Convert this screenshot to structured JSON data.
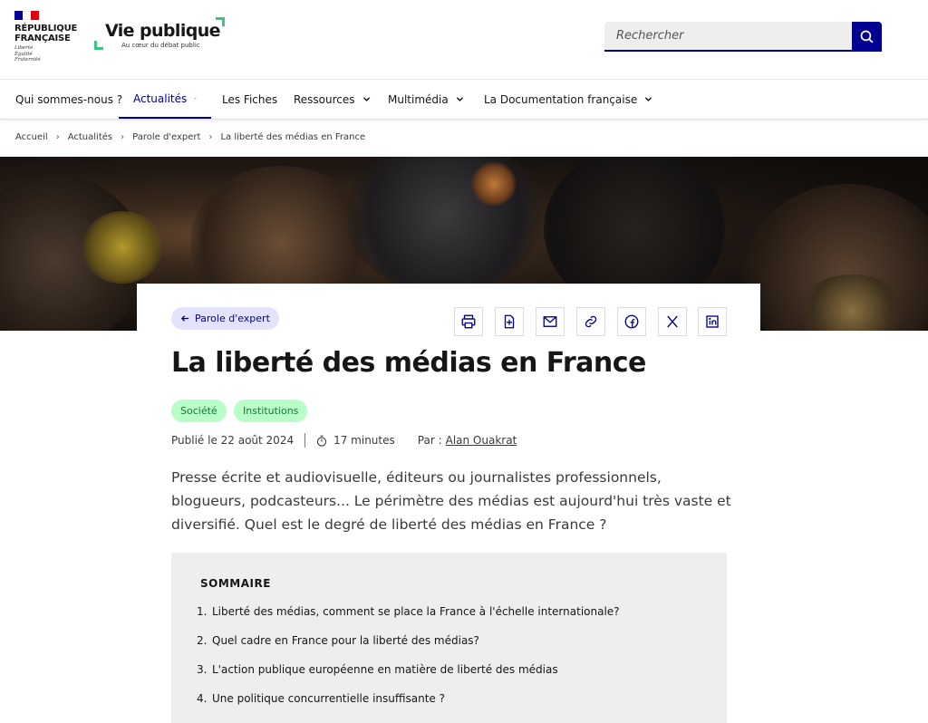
{
  "header": {
    "rf_name_line1": "RÉPUBLIQUE",
    "rf_name_line2": "FRANÇAISE",
    "rf_motto_1": "Liberté",
    "rf_motto_2": "Égalité",
    "rf_motto_3": "Fraternité",
    "site_title": "Vie publique",
    "site_subtitle": "Au cœur du débat public",
    "search_placeholder": "Rechercher",
    "accent_color": "#000091",
    "logo_green": "#3ec27f"
  },
  "nav": {
    "items": [
      {
        "label": "Qui sommes-nous ?",
        "icon": ""
      },
      {
        "label": "Actualités",
        "icon": "chevron-down-icon"
      },
      {
        "label": "Les Fiches",
        "icon": ""
      },
      {
        "label": "Ressources",
        "icon": "chevron-down-icon"
      },
      {
        "label": "Multimédia",
        "icon": "chevron-down-icon"
      },
      {
        "label": "La Documentation française",
        "icon": "chevron-down-icon"
      }
    ],
    "active": "Actualités"
  },
  "breadcrumb": [
    "Accueil",
    "Actualités",
    "Parole d'expert",
    "La liberté des médias en France"
  ],
  "article": {
    "back_label": "Parole d'expert",
    "share_icons": [
      "print-icon",
      "download-icon",
      "mail-icon",
      "link-icon",
      "facebook-icon",
      "x-icon",
      "linkedin-icon"
    ],
    "title": "La liberté des médias en France",
    "tags": [
      "Société",
      "Institutions"
    ],
    "published": "Publié le 22 août 2024",
    "reading_time": "17 minutes",
    "author_prefix": "Par :",
    "author": "Alan Ouakrat",
    "lead": "Presse écrite et audiovisuelle, éditeurs ou journalistes professionnels, blogueurs, podcasteurs... Le périmètre des médias est aujourd'hui très vaste et diversifié. Quel est le degré de liberté des médias en France ?"
  },
  "toc": {
    "title": "SOMMAIRE",
    "items": [
      {
        "num": "1.",
        "label": "Liberté des médias, comment se place la France à l'échelle internationale?"
      },
      {
        "num": "2.",
        "label": "Quel cadre en France pour la liberté des médias?"
      },
      {
        "num": "3.",
        "label": "L'action publique européenne en matière de liberté des médias"
      },
      {
        "num": "4.",
        "label": "Une politique concurrentielle insuffisante ?"
      }
    ]
  }
}
